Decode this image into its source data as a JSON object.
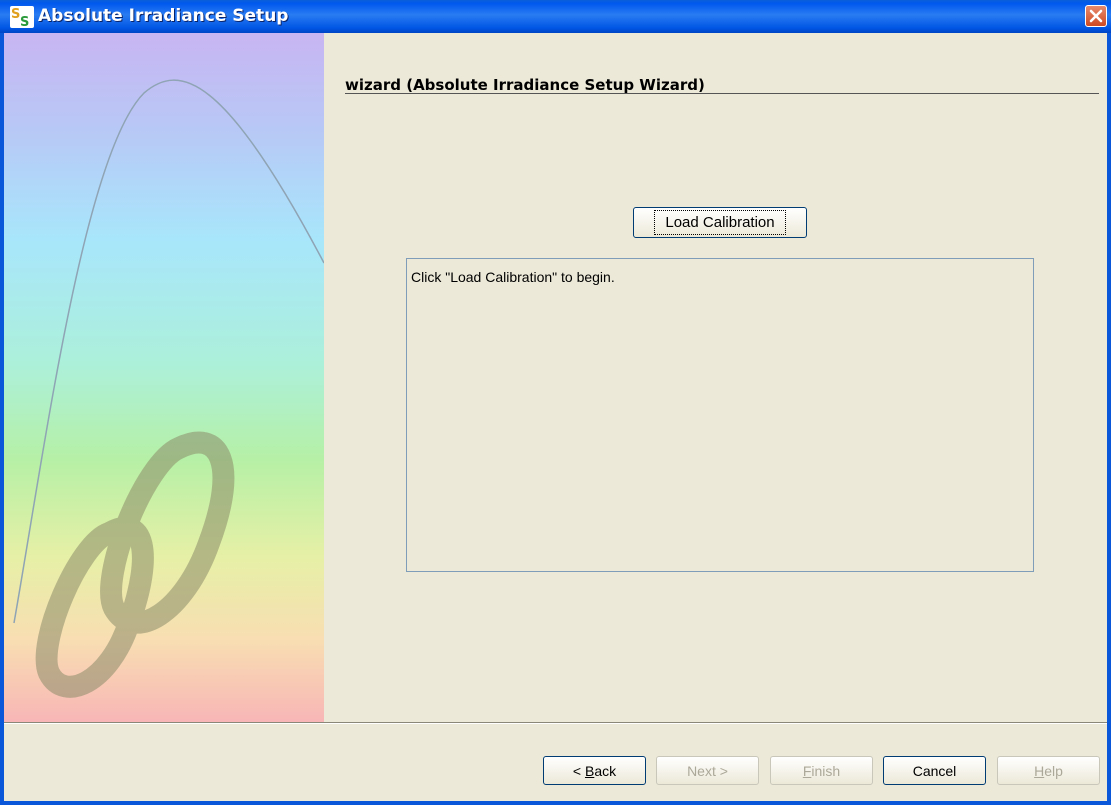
{
  "window": {
    "title": "Absolute Irradiance Setup",
    "app_icon": "spectrasuite-icon",
    "close_icon": "close-icon"
  },
  "wizard": {
    "heading": "wizard (Absolute Irradiance Setup Wizard)",
    "load_button_label": "Load Calibration",
    "message": "Click \"Load Calibration\" to begin."
  },
  "side_panel": {
    "logo": "ocean-optics-logo",
    "colors": [
      "#c8b5f2",
      "#a8e6fb",
      "#b6f0a6",
      "#e6f0a6",
      "#f8b6b6"
    ]
  },
  "buttons": {
    "back": {
      "pre": "< ",
      "mnemonic": "B",
      "post": "ack",
      "enabled": true
    },
    "next": {
      "label": "Next >",
      "enabled": false
    },
    "finish": {
      "mnemonic": "F",
      "post": "inish",
      "enabled": false
    },
    "cancel": {
      "label": "Cancel",
      "enabled": true
    },
    "help": {
      "mnemonic": "H",
      "post": "elp",
      "enabled": false
    }
  },
  "colors": {
    "titlebar": "#0058ee",
    "window_bg": "#ece9d8",
    "close_button": "#cf4a22"
  }
}
